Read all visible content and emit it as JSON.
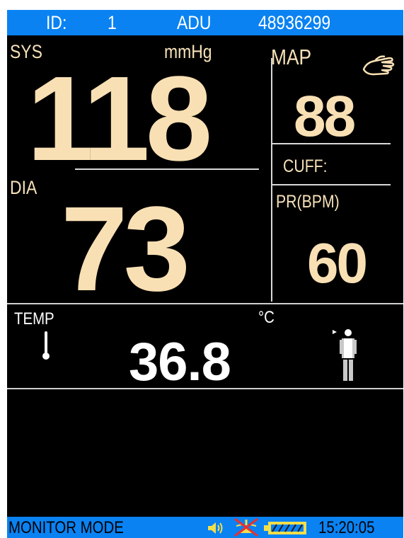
{
  "header": {
    "id_label": "ID:",
    "id_value": "1",
    "patient_type": "ADU",
    "serial": "48936299"
  },
  "bp": {
    "sys_label": "SYS",
    "unit": "mmHg",
    "sys_value": "118",
    "dia_label": "DIA",
    "dia_value": "73",
    "map_label": "MAP",
    "map_value": "88",
    "cuff_label": "CUFF:",
    "pr_label": "PR(BPM)",
    "pr_value": "60"
  },
  "temp": {
    "label": "TEMP",
    "unit": "°C",
    "value": "36.8"
  },
  "status": {
    "mode": "MONITOR MODE",
    "time": "15:20:05"
  },
  "colors": {
    "bar": "#0a82f2",
    "value": "#f9e0b4",
    "background": "#000000"
  },
  "icons": [
    "hand-icon",
    "thermometer-icon",
    "patient-figure-icon",
    "speaker-icon",
    "alarm-off-icon",
    "battery-icon"
  ]
}
